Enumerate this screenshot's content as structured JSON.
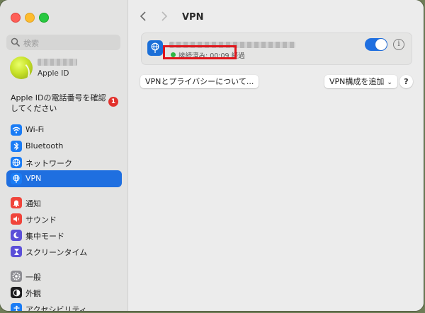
{
  "sidebar": {
    "search_placeholder": "検索",
    "profile": {
      "subtitle": "Apple ID"
    },
    "apple_id_notice": "Apple IDの電話番号を確認してください",
    "notice_badge": "1",
    "items": [
      {
        "label": "Wi-Fi",
        "icon": "wifi-icon",
        "color": "#1a7cf5"
      },
      {
        "label": "Bluetooth",
        "icon": "bluetooth-icon",
        "color": "#1a7cf5"
      },
      {
        "label": "ネットワーク",
        "icon": "globe-icon",
        "color": "#1a7cf5"
      },
      {
        "label": "VPN",
        "icon": "vpn-globe-icon",
        "color": "#1a7cf5",
        "active": true
      },
      {
        "label": "通知",
        "icon": "bell-icon",
        "color": "#f0443a"
      },
      {
        "label": "サウンド",
        "icon": "speaker-icon",
        "color": "#f0443a"
      },
      {
        "label": "集中モード",
        "icon": "moon-icon",
        "color": "#5b4fd8"
      },
      {
        "label": "スクリーンタイム",
        "icon": "hourglass-icon",
        "color": "#5b4fd8"
      },
      {
        "label": "一般",
        "icon": "gear-icon",
        "color": "#8e8e93"
      },
      {
        "label": "外観",
        "icon": "appearance-icon",
        "color": "#1c1c1e"
      },
      {
        "label": "アクセシビリティ",
        "icon": "accessibility-icon",
        "color": "#1a7cf5"
      }
    ]
  },
  "header": {
    "title": "VPN"
  },
  "vpn": {
    "status": "接続済み: 00:09 経過",
    "status_color": "#2fb644",
    "enabled": true
  },
  "buttons": {
    "privacy": "VPNとプライバシーについて...",
    "add_vpn": "VPN構成を追加",
    "help": "?"
  },
  "colors": {
    "accent": "#1f6fe0",
    "highlight": "#e0161c"
  }
}
